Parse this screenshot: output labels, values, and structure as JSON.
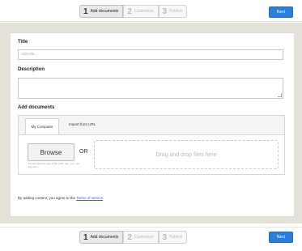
{
  "steps": [
    {
      "num": "1",
      "label": "Add documents"
    },
    {
      "num": "2",
      "label": "Customize"
    },
    {
      "num": "3",
      "label": "Publish"
    }
  ],
  "next_label": "Next",
  "form": {
    "title_label": "Title",
    "title_placeholder": "Add title...",
    "description_label": "Description",
    "add_documents_label": "Add documents"
  },
  "upload": {
    "tabs": [
      "My Computer",
      "Import from URL"
    ],
    "browse_label": "Browse",
    "or_label": "OR",
    "hint": "You can add any type of file (.pdf, .doc, .ppt, .xls, .jpg, etc.) ...",
    "drop_label": "Drag and drop files here"
  },
  "terms": {
    "prefix": "By adding content, you agree to the ",
    "link": "Terms of service",
    "suffix": "."
  },
  "colors": {
    "accent": "#2a7fd8",
    "panel_bg": "#e4e1d9",
    "link": "#2a6fd0"
  }
}
